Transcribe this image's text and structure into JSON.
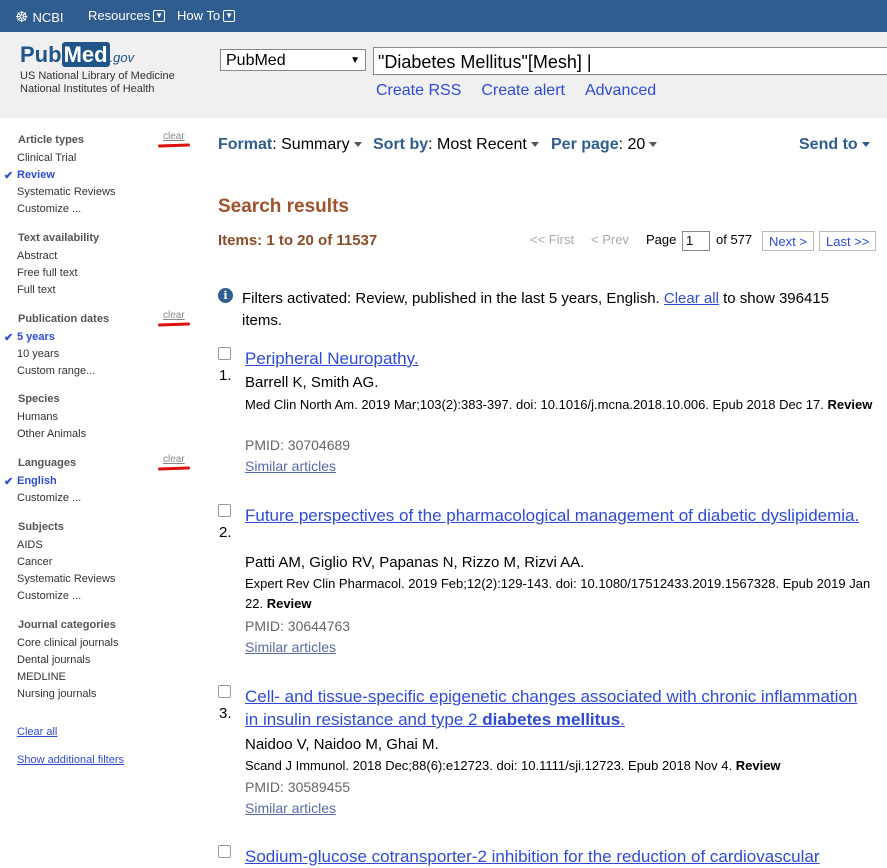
{
  "topbar": {
    "ncbi_label": "NCBI",
    "resources_label": "Resources",
    "howto_label": "How To"
  },
  "header": {
    "logo_pub": "Pub",
    "logo_med": "Med",
    "logo_gov": ".gov",
    "subtitle_line1": "US National Library of Medicine",
    "subtitle_line2": "National Institutes of Health",
    "database_selected": "PubMed",
    "search_value": "\"Diabetes Mellitus\"[Mesh]",
    "links": {
      "create_rss": "Create RSS",
      "create_alert": "Create alert",
      "advanced": "Advanced"
    }
  },
  "sidebar": {
    "clear_label": "clear",
    "article_types": {
      "title": "Article types",
      "items": [
        "Clinical Trial",
        "Review",
        "Systematic Reviews",
        "Customize ..."
      ],
      "selected": "Review"
    },
    "text_availability": {
      "title": "Text availability",
      "items": [
        "Abstract",
        "Free full text",
        "Full text"
      ]
    },
    "publication_dates": {
      "title": "Publication dates",
      "items": [
        "5 years",
        "10 years",
        "Custom range..."
      ],
      "selected": "5 years"
    },
    "species": {
      "title": "Species",
      "items": [
        "Humans",
        "Other Animals"
      ]
    },
    "languages": {
      "title": "Languages",
      "items": [
        "English",
        "Customize ..."
      ],
      "selected": "English"
    },
    "subjects": {
      "title": "Subjects",
      "items": [
        "AIDS",
        "Cancer",
        "Systematic Reviews",
        "Customize ..."
      ]
    },
    "journal_categories": {
      "title": "Journal categories",
      "items": [
        "Core clinical journals",
        "Dental journals",
        "MEDLINE",
        "Nursing journals"
      ]
    },
    "clear_all": "Clear all",
    "show_additional": "Show additional filters"
  },
  "controls": {
    "format_label": "Format",
    "format_value": "Summary",
    "sort_label": "Sort by",
    "sort_value": "Most Recent",
    "perpage_label": "Per page",
    "perpage_value": "20",
    "send_to": "Send to"
  },
  "results": {
    "title": "Search results",
    "items_count": "Items: 1 to 20 of 11537",
    "pager": {
      "first": "<< First",
      "prev": "< Prev",
      "page_label": "Page",
      "page_value": "1",
      "of_label": "of 577",
      "next": "Next >",
      "last": "Last >>"
    },
    "notice": {
      "prefix": "Filters activated: Review, published in the last 5 years, English.",
      "clear_all": "Clear all",
      "suffix": "to show 396415 items."
    },
    "list": [
      {
        "num": "1.",
        "title": "Peripheral Neuropathy.",
        "authors": "Barrell K, Smith AG.",
        "citation": "Med Clin North Am. 2019 Mar;103(2):383-397. doi: 10.1016/j.mcna.2018.10.006. Epub 2018 Dec 17.",
        "type": "Review",
        "pmid": "PMID: 30704689",
        "similar": "Similar articles"
      },
      {
        "num": "2.",
        "title": "Future perspectives of the pharmacological management of diabetic dyslipidemia.",
        "authors": "Patti AM, Giglio RV, Papanas N, Rizzo M, Rizvi AA.",
        "citation": "Expert Rev Clin Pharmacol. 2019 Feb;12(2):129-143. doi: 10.1080/17512433.2019.1567328. Epub 2019 Jan 22.",
        "type": "Review",
        "pmid": "PMID: 30644763",
        "similar": "Similar articles"
      },
      {
        "num": "3.",
        "title": "Cell- and tissue-specific epigenetic changes associated with chronic inflammation in insulin resistance and type 2",
        "title_bold": "diabetes mellitus",
        "title_end": ".",
        "authors": "Naidoo V, Naidoo M, Ghai M.",
        "citation": "Scand J Immunol. 2018 Dec;88(6):e12723. doi: 10.1111/sji.12723. Epub 2018 Nov 4.",
        "type": "Review",
        "pmid": "PMID: 30589455",
        "similar": "Similar articles"
      },
      {
        "title": "Sodium-glucose cotransporter-2 inhibition for the reduction of cardiovascular"
      }
    ]
  }
}
